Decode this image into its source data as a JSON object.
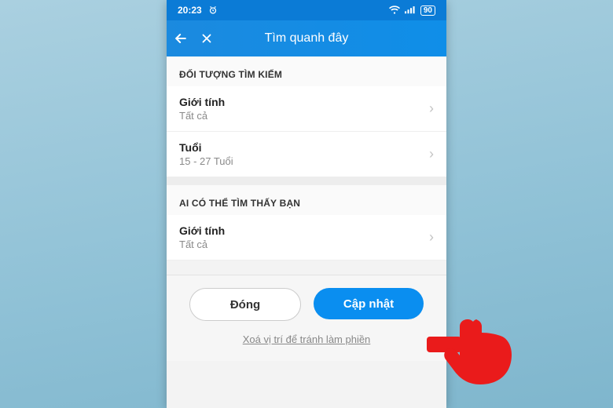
{
  "status": {
    "time": "20:23",
    "battery": "90"
  },
  "appbar": {
    "title": "Tìm quanh đây"
  },
  "sections": {
    "search_target_header": "ĐỐI TƯỢNG TÌM KIẾM",
    "gender": {
      "label": "Giới tính",
      "value": "Tất cả"
    },
    "age": {
      "label": "Tuổi",
      "value": "15 - 27 Tuổi"
    },
    "visibility_header": "AI CÓ THỂ TÌM THẤY BẠN",
    "vis_gender": {
      "label": "Giới tính",
      "value": "Tất cả"
    }
  },
  "actions": {
    "close": "Đóng",
    "update": "Cập nhật",
    "clear_location": "Xoá vị trí để tránh làm phiền"
  }
}
